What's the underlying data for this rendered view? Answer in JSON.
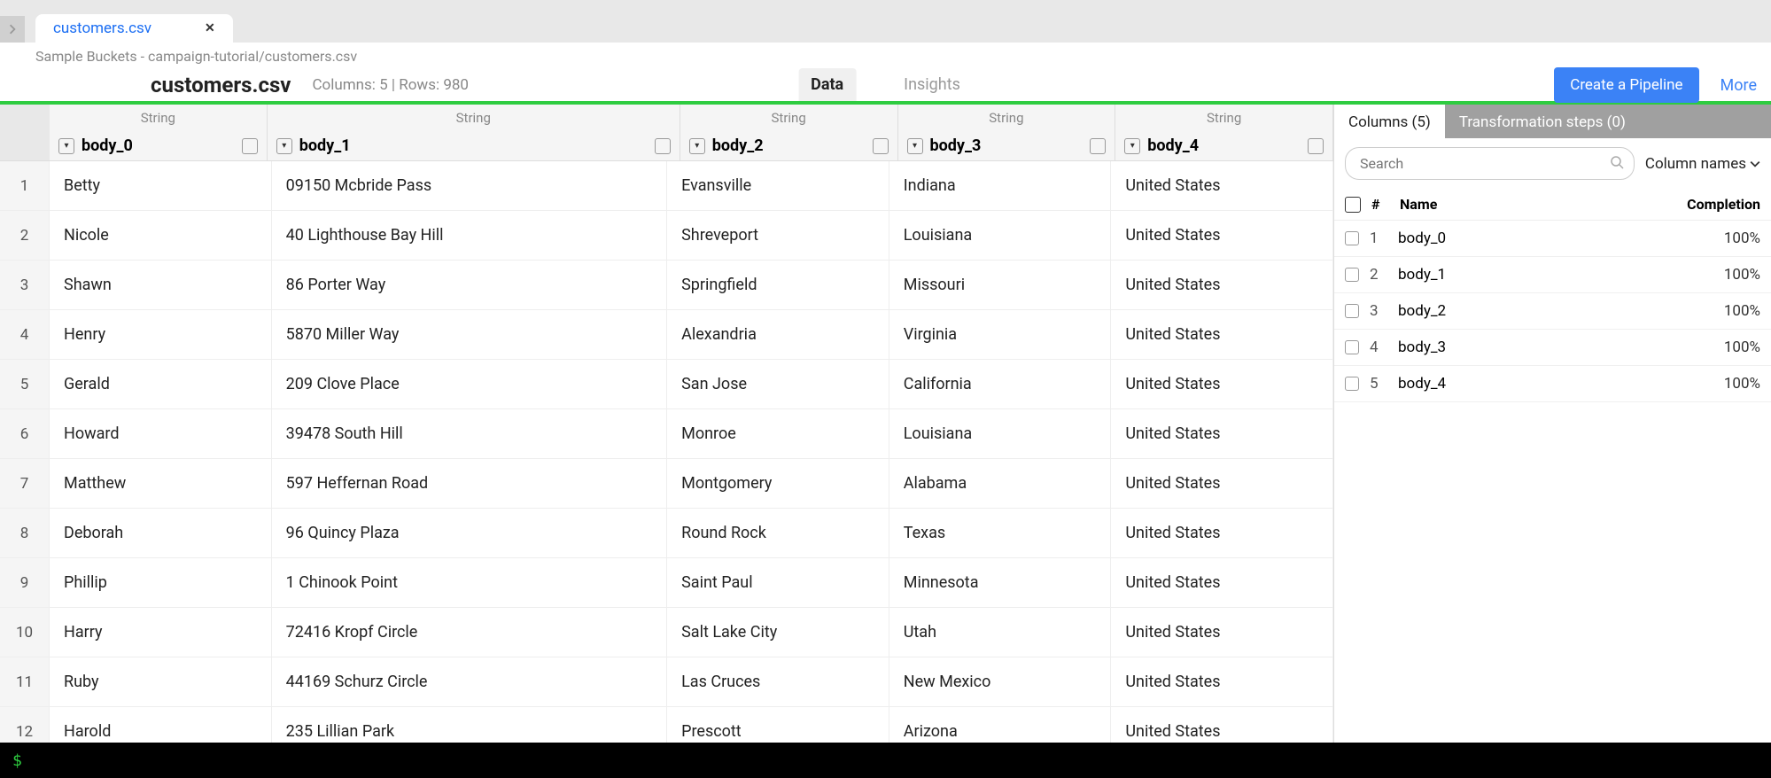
{
  "tab": {
    "label": "customers.csv"
  },
  "breadcrumb": "Sample Buckets - campaign-tutorial/customers.csv",
  "header": {
    "filename": "customers.csv",
    "meta": "Columns: 5 | Rows: 980",
    "tab_data": "Data",
    "tab_insights": "Insights",
    "create_pipeline": "Create a Pipeline",
    "more": "More"
  },
  "columns": [
    {
      "type": "String",
      "name": "body_0"
    },
    {
      "type": "String",
      "name": "body_1"
    },
    {
      "type": "String",
      "name": "body_2"
    },
    {
      "type": "String",
      "name": "body_3"
    },
    {
      "type": "String",
      "name": "body_4"
    }
  ],
  "rows": [
    {
      "n": "1",
      "c": [
        "Betty",
        "09150 Mcbride Pass",
        "Evansville",
        "Indiana",
        "United States"
      ]
    },
    {
      "n": "2",
      "c": [
        "Nicole",
        "40 Lighthouse Bay Hill",
        "Shreveport",
        "Louisiana",
        "United States"
      ]
    },
    {
      "n": "3",
      "c": [
        "Shawn",
        "86 Porter Way",
        "Springfield",
        "Missouri",
        "United States"
      ]
    },
    {
      "n": "4",
      "c": [
        "Henry",
        "5870 Miller Way",
        "Alexandria",
        "Virginia",
        "United States"
      ]
    },
    {
      "n": "5",
      "c": [
        "Gerald",
        "209 Clove Place",
        "San Jose",
        "California",
        "United States"
      ]
    },
    {
      "n": "6",
      "c": [
        "Howard",
        "39478 South Hill",
        "Monroe",
        "Louisiana",
        "United States"
      ]
    },
    {
      "n": "7",
      "c": [
        "Matthew",
        "597 Heffernan Road",
        "Montgomery",
        "Alabama",
        "United States"
      ]
    },
    {
      "n": "8",
      "c": [
        "Deborah",
        "96 Quincy Plaza",
        "Round Rock",
        "Texas",
        "United States"
      ]
    },
    {
      "n": "9",
      "c": [
        "Phillip",
        "1 Chinook Point",
        "Saint Paul",
        "Minnesota",
        "United States"
      ]
    },
    {
      "n": "10",
      "c": [
        "Harry",
        "72416 Kropf Circle",
        "Salt Lake City",
        "Utah",
        "United States"
      ]
    },
    {
      "n": "11",
      "c": [
        "Ruby",
        "44169 Schurz Circle",
        "Las Cruces",
        "New Mexico",
        "United States"
      ]
    },
    {
      "n": "12",
      "c": [
        "Harold",
        "235 Lillian Park",
        "Prescott",
        "Arizona",
        "United States"
      ]
    }
  ],
  "sidepanel": {
    "tab_columns": "Columns (5)",
    "tab_transform": "Transformation steps (0)",
    "search_placeholder": "Search",
    "filter_label": "Column names",
    "head_num": "#",
    "head_name": "Name",
    "head_completion": "Completion",
    "rows": [
      {
        "n": "1",
        "name": "body_0",
        "pct": "100%"
      },
      {
        "n": "2",
        "name": "body_1",
        "pct": "100%"
      },
      {
        "n": "3",
        "name": "body_2",
        "pct": "100%"
      },
      {
        "n": "4",
        "name": "body_3",
        "pct": "100%"
      },
      {
        "n": "5",
        "name": "body_4",
        "pct": "100%"
      }
    ]
  },
  "terminal_prompt": "$"
}
